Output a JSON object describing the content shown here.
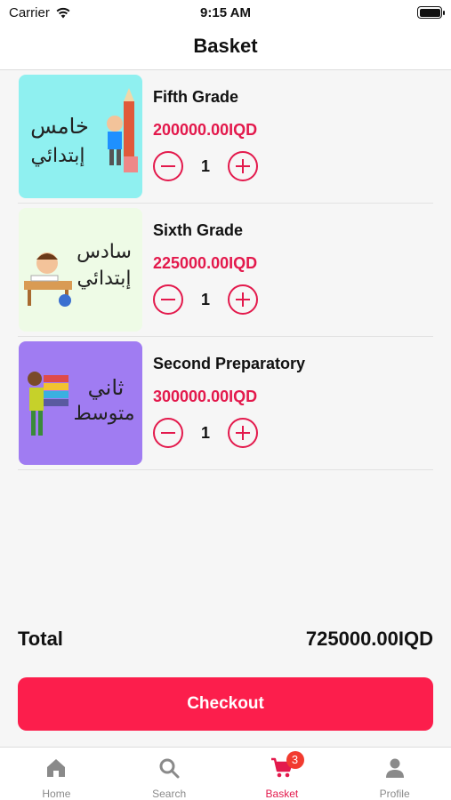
{
  "status_bar": {
    "carrier": "Carrier",
    "time": "9:15 AM"
  },
  "header": {
    "title": "Basket"
  },
  "items": [
    {
      "name": "Fifth Grade",
      "price": "200000.00IQD",
      "quantity": "1",
      "thumb_text_line1": "خامس",
      "thumb_text_line2": "إبتدائي",
      "thumb_bg": "#8ff0f0"
    },
    {
      "name": "Sixth Grade",
      "price": "225000.00IQD",
      "quantity": "1",
      "thumb_text_line1": "سادس",
      "thumb_text_line2": "إبتدائي",
      "thumb_bg": "#eefbe6"
    },
    {
      "name": "Second Preparatory",
      "price": "300000.00IQD",
      "quantity": "1",
      "thumb_text_line1": "ثاني",
      "thumb_text_line2": "متوسط",
      "thumb_bg": "#a07cf2"
    }
  ],
  "total": {
    "label": "Total",
    "value": "725000.00IQD"
  },
  "checkout": {
    "label": "Checkout"
  },
  "tabbar": {
    "tabs": [
      {
        "label": "Home",
        "icon": "home-icon"
      },
      {
        "label": "Search",
        "icon": "search-icon"
      },
      {
        "label": "Basket",
        "icon": "cart-icon",
        "active": true,
        "badge": "3"
      },
      {
        "label": "Profile",
        "icon": "person-icon"
      }
    ]
  },
  "colors": {
    "accent": "#e3194c",
    "checkout_bg": "#fc1e4c",
    "badge": "#f23b2f"
  }
}
